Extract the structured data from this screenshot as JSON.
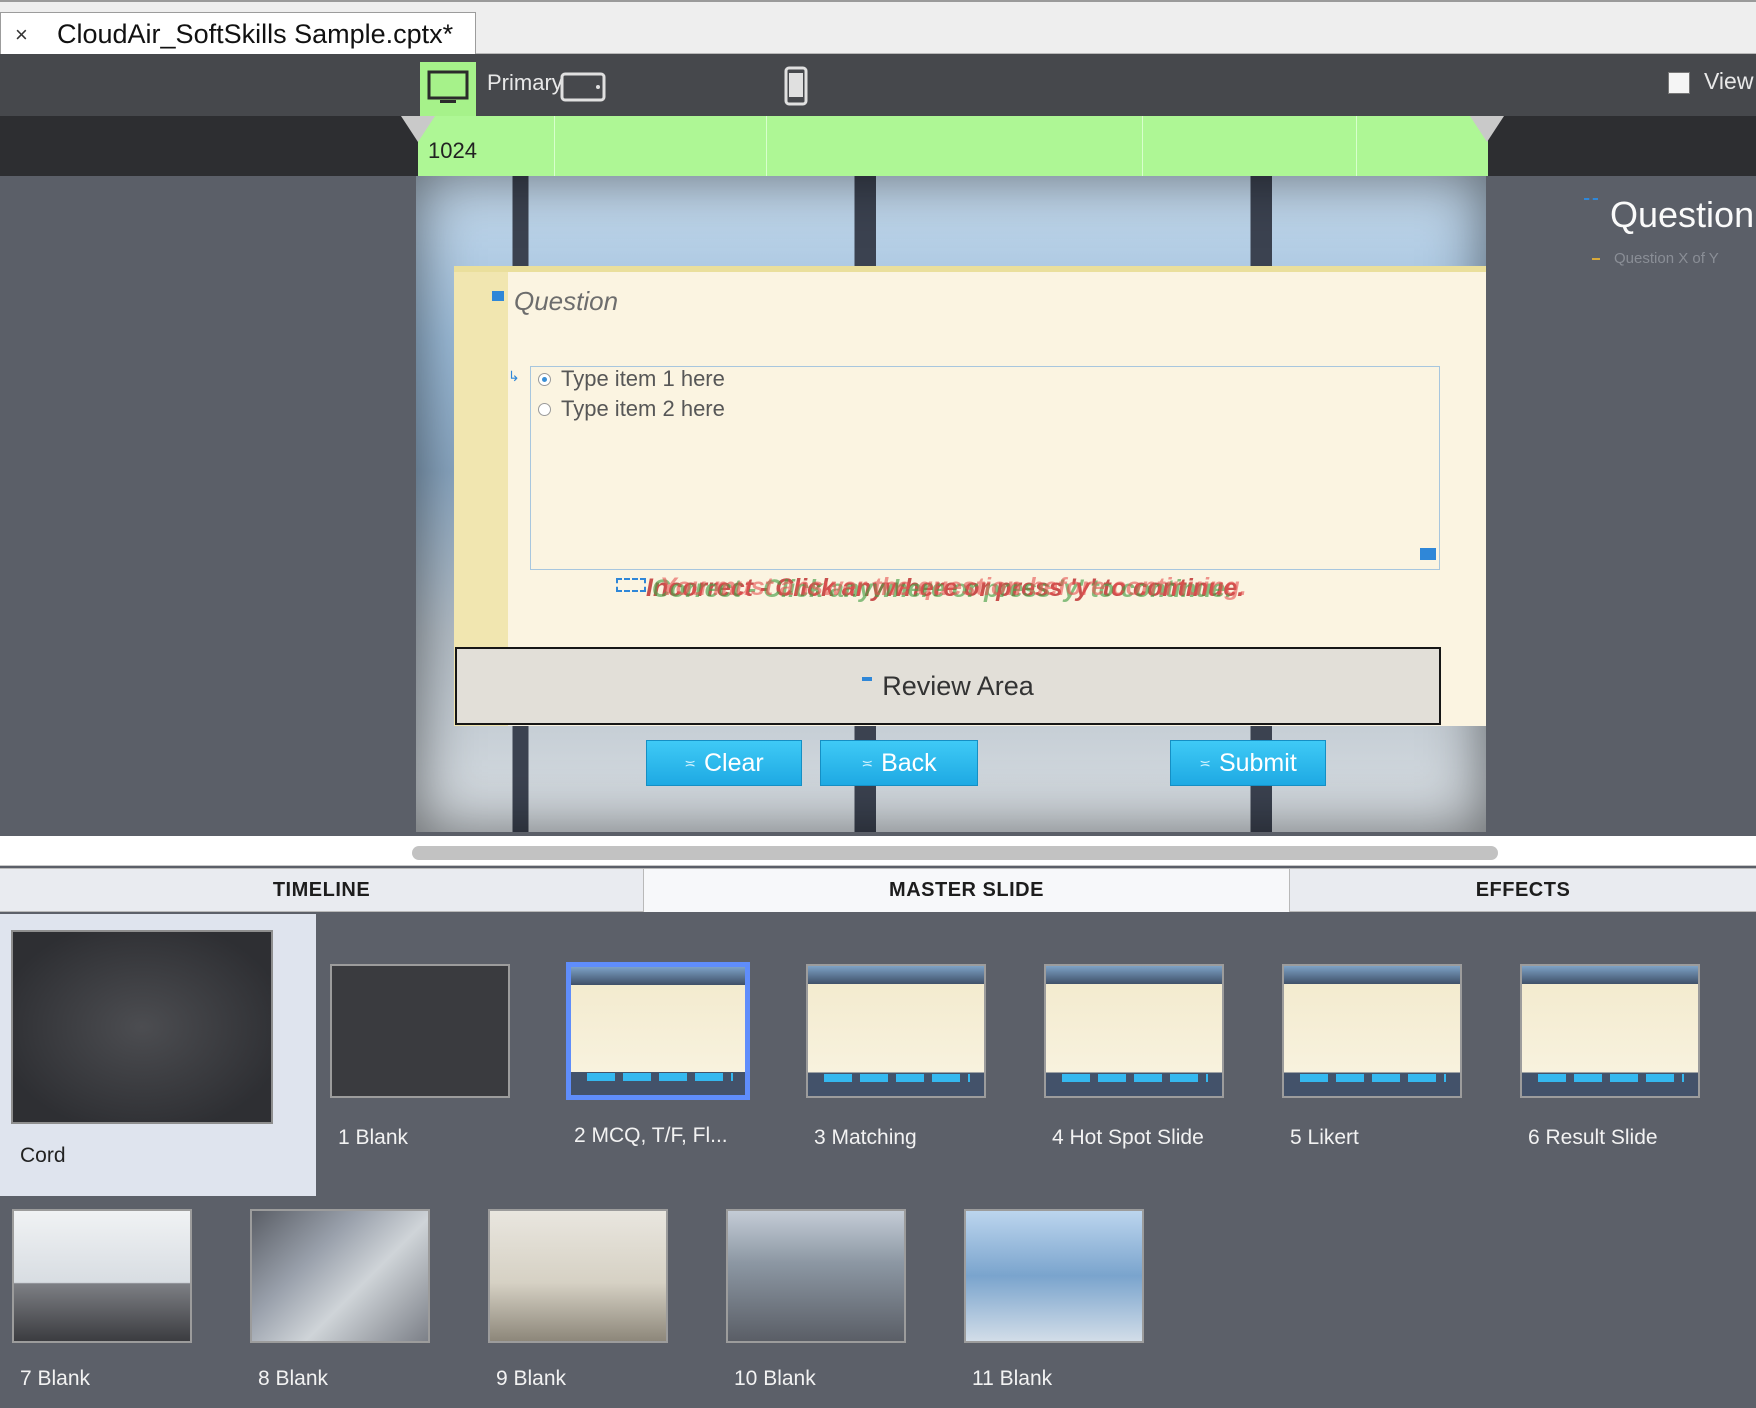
{
  "tab": {
    "close": "×",
    "title": "CloudAir_SoftSkills Sample.cptx*"
  },
  "toolbar": {
    "devices": [
      {
        "icon": "desktop-icon",
        "label": "Primary"
      },
      {
        "icon": "tablet-icon"
      },
      {
        "icon": "phone-icon"
      }
    ],
    "view_label": "View"
  },
  "ruler": {
    "breakpoint": "1024"
  },
  "slide": {
    "question_title": "Question",
    "answers": [
      {
        "text": "Type item 1 here",
        "selected": true
      },
      {
        "text": "Type item 2 here",
        "selected": false
      }
    ],
    "feedback_lines": [
      "Incorrect - Click anywhere or press 'y' to continue.",
      "Correct - Click anywhere or press 'y' to continue.",
      "You must answer the question before continuing."
    ],
    "review_area": "Review Area",
    "buttons": {
      "clear": "Clear",
      "back": "Back",
      "submit": "Submit"
    },
    "side_title": "Question",
    "side_subtitle": "Question X of Y"
  },
  "panel_tabs": {
    "timeline": "TIMELINE",
    "master_slide": "MASTER SLIDE",
    "effects": "EFFECTS"
  },
  "master": {
    "main_label": "Cord",
    "layouts": [
      {
        "label": "1 Blank",
        "selected": false
      },
      {
        "label": "2 MCQ, T/F, Fl...",
        "selected": true
      },
      {
        "label": "3 Matching",
        "selected": false
      },
      {
        "label": "4 Hot Spot Slide",
        "selected": false
      },
      {
        "label": "5 Likert",
        "selected": false
      },
      {
        "label": "6 Result Slide",
        "selected": false
      },
      {
        "label": "7 Blank",
        "selected": false
      },
      {
        "label": "8 Blank",
        "selected": false
      },
      {
        "label": "9 Blank",
        "selected": false
      },
      {
        "label": "10 Blank",
        "selected": false
      },
      {
        "label": "11 Blank",
        "selected": false
      }
    ]
  },
  "colors": {
    "accent_green": "#aef795",
    "button_blue": "#1ea9e3",
    "selection_blue": "#5f8dfb"
  }
}
